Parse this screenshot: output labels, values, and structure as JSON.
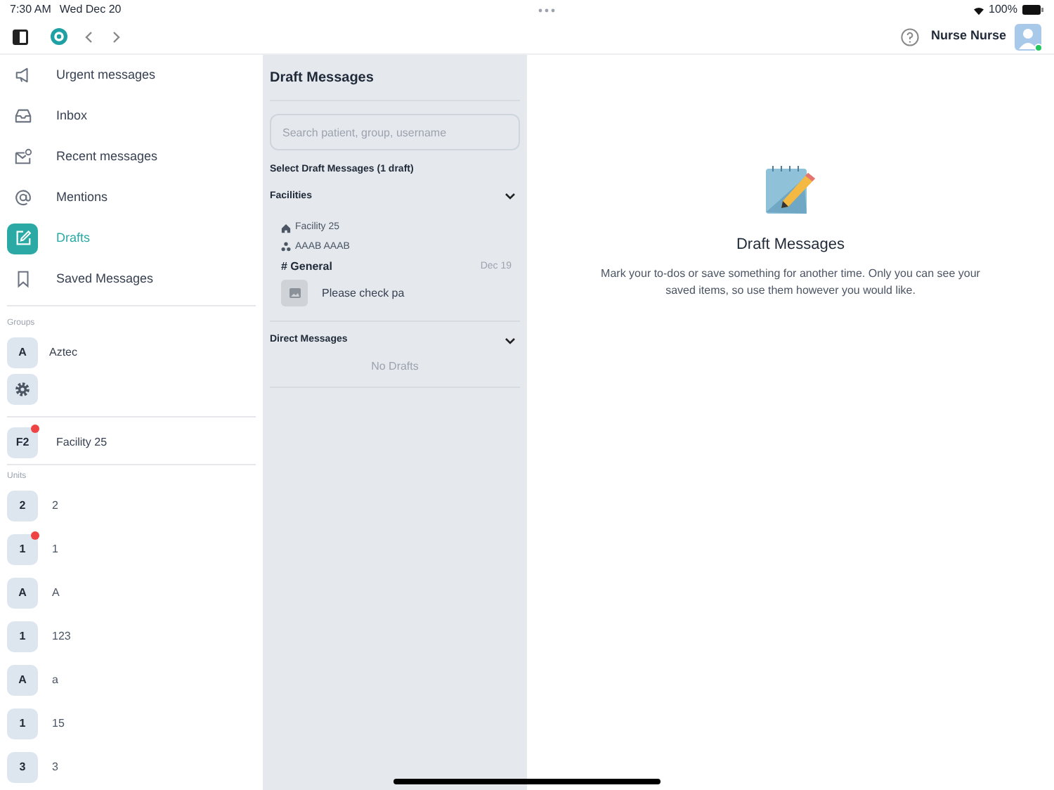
{
  "status_bar": {
    "time": "7:30 AM",
    "date": "Wed Dec 20",
    "battery": "100%"
  },
  "toolbar": {
    "user_name": "Nurse Nurse",
    "online": true
  },
  "nav": [
    {
      "label": "Urgent messages",
      "selected": false
    },
    {
      "label": "Inbox",
      "selected": false
    },
    {
      "label": "Recent messages",
      "selected": false
    },
    {
      "label": "Mentions",
      "selected": false
    },
    {
      "label": "Drafts",
      "selected": true
    },
    {
      "label": "Saved Messages",
      "selected": false
    }
  ],
  "groups": {
    "heading": "Groups",
    "items": [
      {
        "kind": "group",
        "initial": "A",
        "label": "Aztec",
        "unread": false
      },
      {
        "kind": "settings"
      }
    ]
  },
  "facility": {
    "initial": "F2",
    "label": "Facility 25",
    "unread": true
  },
  "units": {
    "heading": "Units",
    "items": [
      {
        "initial": "2",
        "label": "2",
        "unread": false
      },
      {
        "initial": "1",
        "label": "1",
        "unread": true
      },
      {
        "initial": "A",
        "label": "A",
        "unread": false
      },
      {
        "initial": "1",
        "label": "123",
        "unread": false
      },
      {
        "initial": "A",
        "label": "a",
        "unread": false
      },
      {
        "initial": "1",
        "label": "15",
        "unread": false
      },
      {
        "initial": "3",
        "label": "3",
        "unread": false
      }
    ]
  },
  "drafts": {
    "title": "Draft Messages",
    "search_placeholder": "Search patient, group, username",
    "subtitle": "Select Draft Messages (1 draft)",
    "sections": [
      {
        "title": "Facilities",
        "expanded": true,
        "drafts": [
          {
            "facility": "Facility 25",
            "unit": "AAAB AAAB",
            "channel": "# General",
            "date": "Dec 19",
            "preview": "Please check pa"
          }
        ]
      },
      {
        "title": "Direct Messages",
        "expanded": true,
        "empty_text": "No Drafts"
      }
    ]
  },
  "detail": {
    "title": "Draft Messages",
    "description": "Mark your to-dos or save something for another time. Only you can see your saved items, so use them however you would like."
  }
}
